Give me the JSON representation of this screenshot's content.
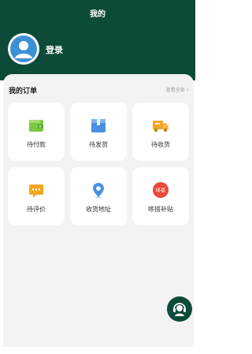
{
  "header": {
    "title": "我的",
    "login_label": "登录"
  },
  "orders": {
    "title": "我的订单",
    "view_all": "查看全部",
    "items": [
      {
        "label": "待付款",
        "icon": "wallet-icon",
        "color": "#7ac943"
      },
      {
        "label": "待发货",
        "icon": "package-icon",
        "color": "#4a90e2"
      },
      {
        "label": "待收货",
        "icon": "delivery-truck-icon",
        "color": "#f5a623"
      },
      {
        "label": "待评价",
        "icon": "chat-bubble-icon",
        "color": "#f5a623"
      },
      {
        "label": "收货地址",
        "icon": "location-pin-icon",
        "color": "#4a90e2"
      },
      {
        "label": "哆搭补贴",
        "icon": "subsidy-badge-icon",
        "color": "#e74c3c",
        "badge_text": "哆搭"
      }
    ]
  },
  "colors": {
    "brand": "#0d4a3a",
    "sheet_bg": "#f3f3f3"
  }
}
